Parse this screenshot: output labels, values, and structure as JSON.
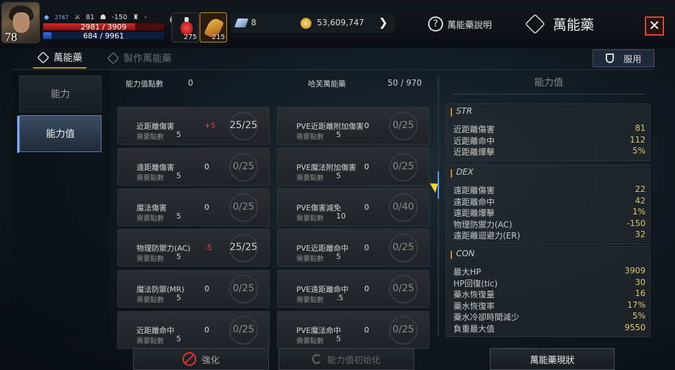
{
  "hud": {
    "level": "78",
    "stat_mp_power": "2767",
    "stat_attack": "81",
    "stat_defense": "-150",
    "stat_trophy": "-",
    "hp_text": "2981 / 3909",
    "hp_fraction": 0.76,
    "mp_text": "684 / 9961",
    "mp_fraction": 0.07,
    "slot1_count": "275",
    "slot2_count": "215",
    "gem_count": "8",
    "gold_count": "53,609,747"
  },
  "header": {
    "help_label": "萬能藥說明",
    "title": "萬能藥",
    "close_symbol": "✕"
  },
  "tabs": [
    {
      "label": "萬能藥",
      "active": true
    },
    {
      "label": "製作萬能藥",
      "active": false
    }
  ],
  "use_button_label": "服用",
  "nav": [
    {
      "label": "能力"
    },
    {
      "label": "能力值"
    }
  ],
  "summary": {
    "points_label": "能力值點數",
    "points_value": "0",
    "total_label": "哈芙萬能藥",
    "total_value": "50 / 970"
  },
  "req_label": "需要點數",
  "left_column": [
    {
      "name": "近距離傷害",
      "req": "5",
      "bonus": "+5",
      "bonus_red": true,
      "progress": "25/25",
      "full": true
    },
    {
      "name": "遠距離傷害",
      "req": "5",
      "bonus": "0",
      "bonus_red": false,
      "progress": "0/25",
      "full": false
    },
    {
      "name": "魔法傷害",
      "req": "5",
      "bonus": "0",
      "bonus_red": false,
      "progress": "0/25",
      "full": false
    },
    {
      "name": "物理防禦力(AC)",
      "req": "5",
      "bonus": "-5",
      "bonus_red": true,
      "progress": "25/25",
      "full": true
    },
    {
      "name": "魔法防禦(MR)",
      "req": "5",
      "bonus": "0",
      "bonus_red": false,
      "progress": "0/25",
      "full": false
    },
    {
      "name": "近距離命中",
      "req": "5",
      "bonus": "0",
      "bonus_red": false,
      "progress": "0/25",
      "full": false
    }
  ],
  "right_column": [
    {
      "name": "PVE近距離附加傷害",
      "req": "5",
      "bonus": "0",
      "bonus_red": false,
      "progress": "0/25",
      "full": false
    },
    {
      "name": "PVE魔法附加傷害",
      "req": "5",
      "bonus": "0",
      "bonus_red": false,
      "progress": "0/25",
      "full": false
    },
    {
      "name": "PVE傷害減免",
      "req": "10",
      "bonus": "0",
      "bonus_red": false,
      "progress": "0/40",
      "full": false
    },
    {
      "name": "PVE近距離命中",
      "req": "5",
      "bonus": "0",
      "bonus_red": false,
      "progress": "0/25",
      "full": false
    },
    {
      "name": "PVE遠距離命中",
      "req": ".5",
      "bonus": "0",
      "bonus_red": false,
      "progress": "0/25",
      "full": false
    },
    {
      "name": "PVE魔法命中",
      "req": "5",
      "bonus": "0",
      "bonus_red": false,
      "progress": "0/25",
      "full": false
    }
  ],
  "stats_panel": {
    "title": "能力值",
    "groups": [
      {
        "name": "STR",
        "rows": [
          {
            "k": "近距離傷害",
            "v": "81"
          },
          {
            "k": "近距離命中",
            "v": "112"
          },
          {
            "k": "近距離爆擊",
            "v": "5%"
          }
        ]
      },
      {
        "name": "DEX",
        "rows": [
          {
            "k": "遠距離傷害",
            "v": "22"
          },
          {
            "k": "遠距離命中",
            "v": "42"
          },
          {
            "k": "遠距離爆擊",
            "v": "1%"
          },
          {
            "k": "物理防禦力(AC)",
            "v": "-150"
          },
          {
            "k": "遠距離迴避力(ER)",
            "v": "32"
          }
        ]
      },
      {
        "name": "CON",
        "rows": [
          {
            "k": "最大HP",
            "v": "3909"
          },
          {
            "k": "HP回復(tic)",
            "v": "30"
          },
          {
            "k": "藥水恢復量",
            "v": "16"
          },
          {
            "k": "藥水恢復率",
            "v": "17%"
          },
          {
            "k": "藥水冷卻時間減少",
            "v": "5%"
          },
          {
            "k": "負重最大值",
            "v": "9550"
          }
        ]
      }
    ]
  },
  "bottom": {
    "btn1_label": "強化",
    "btn2_label": "能力值初始化",
    "btn3_label": "萬能藥現狀"
  }
}
